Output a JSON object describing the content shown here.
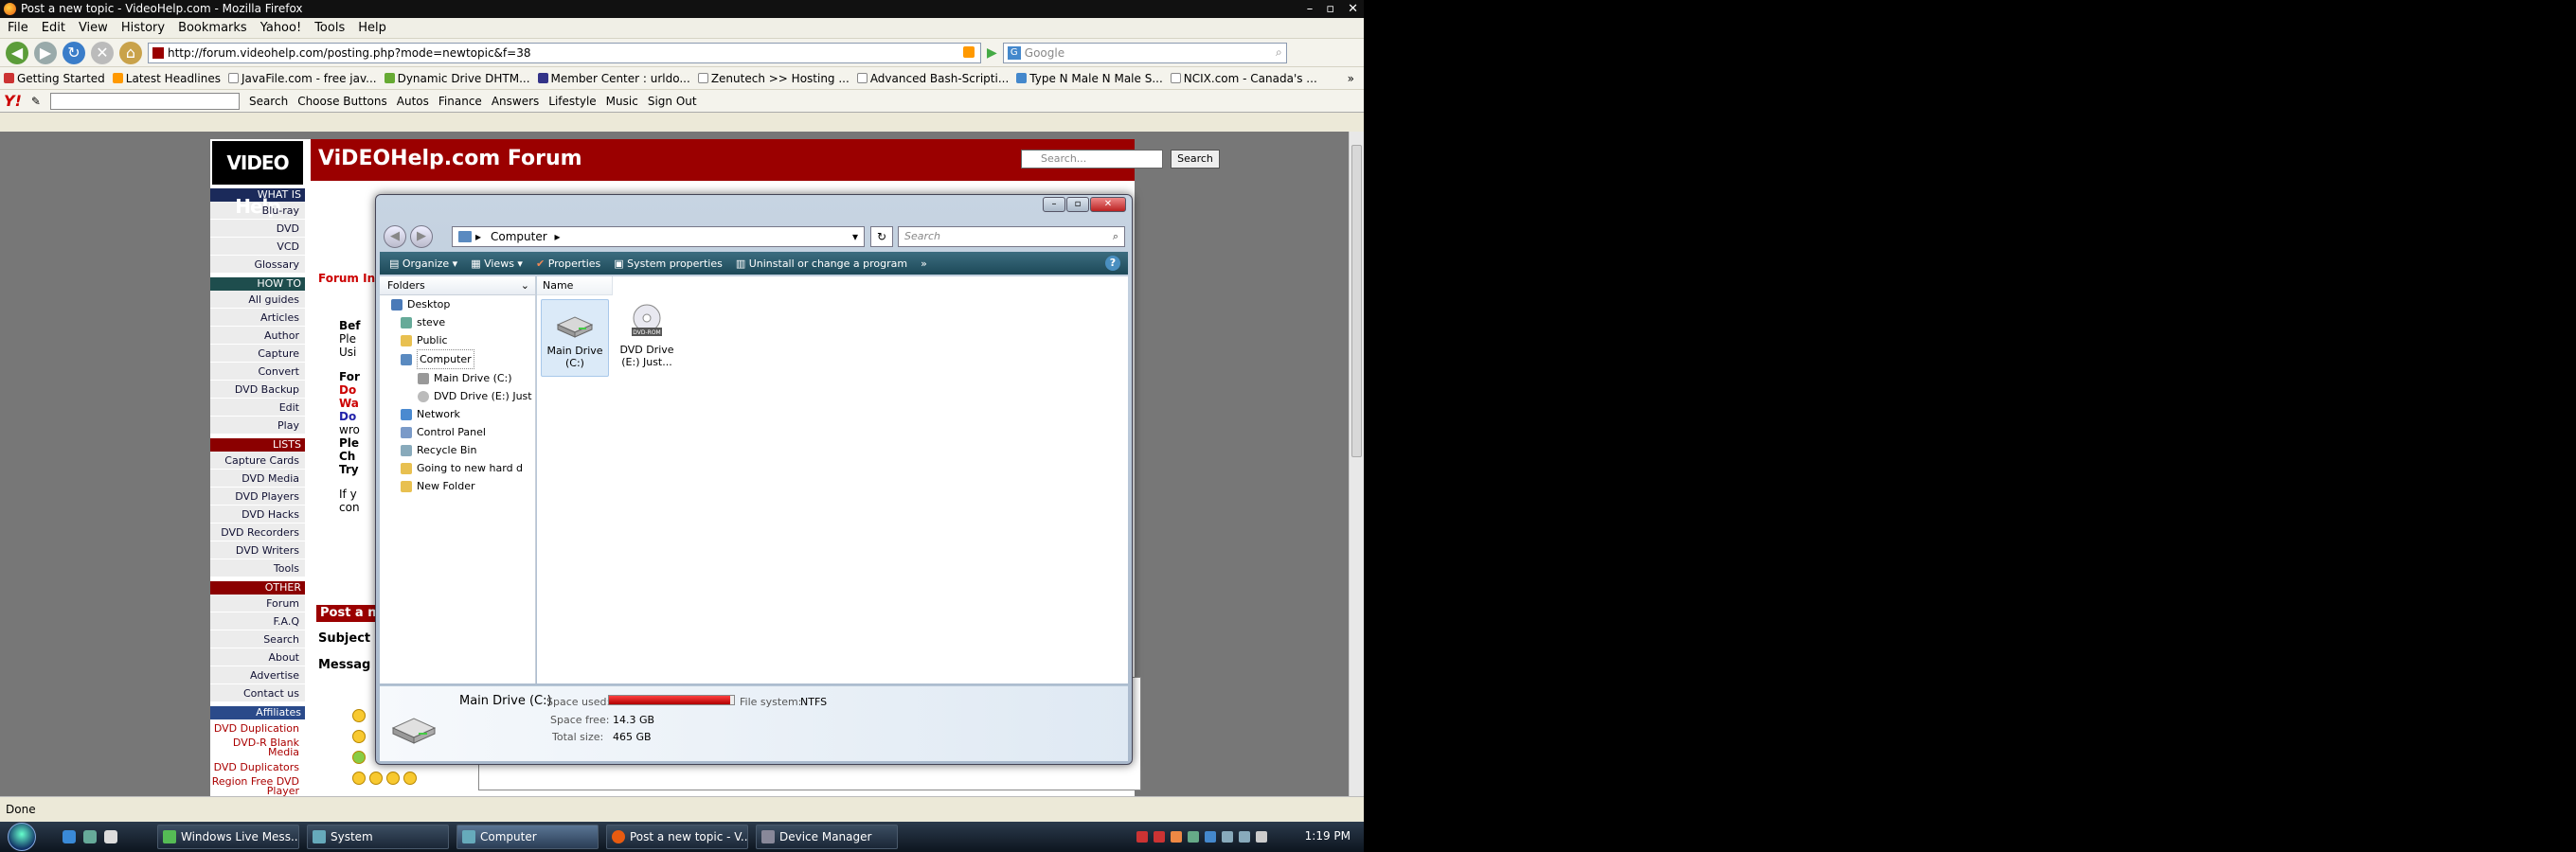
{
  "firefox": {
    "title": "Post a new topic - VideoHelp.com - Mozilla Firefox",
    "menu": [
      "File",
      "Edit",
      "View",
      "History",
      "Bookmarks",
      "Yahoo!",
      "Tools",
      "Help"
    ],
    "url": "http://forum.videohelp.com/posting.php?mode=newtopic&f=38",
    "search_placeholder": "Google",
    "bookmarks": [
      "Getting Started",
      "Latest Headlines",
      "JavaFile.com - free jav...",
      "Dynamic Drive DHTM...",
      "Member Center : urldo...",
      "Zenutech >> Hosting ...",
      "Advanced Bash-Scripti...",
      "Type N Male N Male S...",
      "NCIX.com - Canada's ..."
    ],
    "yahoo_toolbar": {
      "logo": "Y!",
      "search_label": "Search",
      "items": [
        "Choose Buttons",
        "Autos",
        "Finance",
        "Answers",
        "Lifestyle",
        "Music",
        "Sign Out"
      ]
    },
    "status": "Done"
  },
  "site": {
    "logo": "VIDEO Help",
    "header_title": "ViDEOHelp.com Forum",
    "search_placeholder": "Search...",
    "search_button": "Search",
    "sections": [
      {
        "title": "WHAT IS",
        "items": [
          "Blu-ray",
          "DVD",
          "VCD",
          "Glossary"
        ]
      },
      {
        "title": "HOW TO",
        "items": [
          "All guides",
          "Articles",
          "Author",
          "Capture",
          "Convert",
          "DVD Backup",
          "Edit",
          "Play"
        ]
      },
      {
        "title": "LISTS",
        "items": [
          "Capture Cards",
          "DVD Media",
          "DVD Players",
          "DVD Hacks",
          "DVD Recorders",
          "DVD Writers",
          "Tools"
        ]
      },
      {
        "title": "OTHER",
        "items": [
          "Forum",
          "F.A.Q",
          "Search",
          "About",
          "Advertise",
          "Contact us"
        ]
      },
      {
        "title": "Affiliates",
        "items": [
          "DVD Duplication",
          "DVD-R Blank Media",
          "DVD Duplicators",
          "Region Free DVD Player"
        ]
      }
    ],
    "forum_label": "Forum In",
    "body_lines": [
      "Bef",
      "Ple",
      "Usi",
      "For",
      "Do",
      "Wa",
      "Do",
      "wro",
      "Ple",
      "Ch",
      "Try",
      "If y",
      "con"
    ],
    "post_bar": "Post a n",
    "subject_label": "Subject",
    "message_label": "Messag"
  },
  "explorer": {
    "address": "Computer",
    "search_placeholder": "Search",
    "commands": [
      "Organize",
      "Views",
      "Properties",
      "System properties",
      "Uninstall or change a program",
      "»"
    ],
    "folders_label": "Folders",
    "tree": [
      "Desktop",
      "steve",
      "Public",
      "Computer",
      "Main Drive (C:)",
      "DVD Drive (E:) Just",
      "Network",
      "Control Panel",
      "Recycle Bin",
      "Going to new hard d",
      "New Folder"
    ],
    "column_name": "Name",
    "items": [
      {
        "label": "Main Drive (C:)",
        "icon": "hard-drive-icon",
        "selected": true
      },
      {
        "label": "DVD Drive (E:) Just...",
        "icon": "dvd-drive-icon",
        "selected": false
      }
    ],
    "details": {
      "name": "Main Drive (C:)",
      "space_used_label": "Space used:",
      "space_used_fraction": 0.97,
      "file_system_label": "File system:",
      "file_system": "NTFS",
      "space_free_label": "Space free:",
      "space_free": "14.3 GB",
      "total_size_label": "Total size:",
      "total_size": "465 GB"
    }
  },
  "taskbar": {
    "tasks": [
      {
        "label": "Windows Live Mess...",
        "active": false
      },
      {
        "label": "System",
        "active": false
      },
      {
        "label": "Computer",
        "active": true
      },
      {
        "label": "Post a new topic - V...",
        "active": false
      },
      {
        "label": "Device Manager",
        "active": false
      }
    ],
    "clock": "1:19 PM"
  }
}
